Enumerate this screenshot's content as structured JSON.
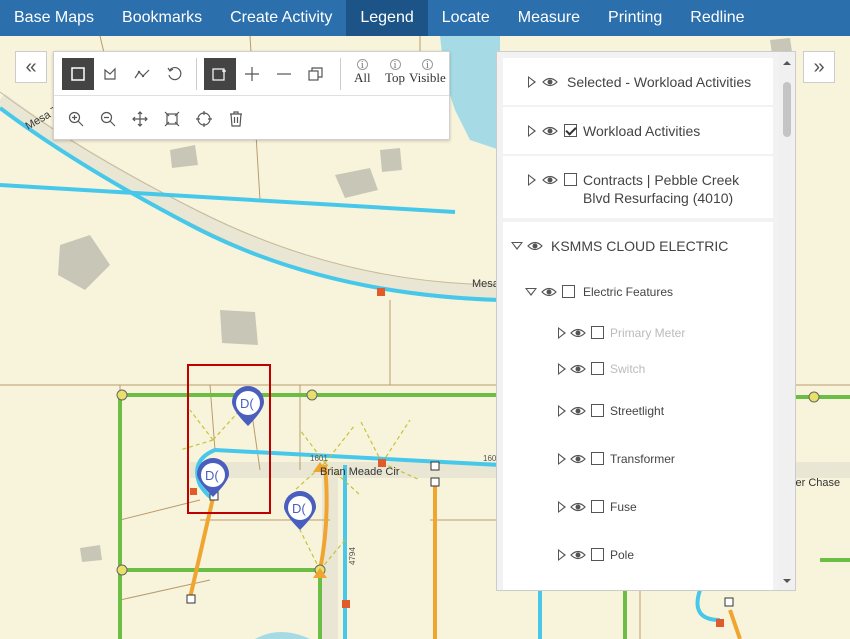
{
  "nav": {
    "items": [
      {
        "label": "Base Maps"
      },
      {
        "label": "Bookmarks"
      },
      {
        "label": "Create Activity"
      },
      {
        "label": "Legend",
        "active": true
      },
      {
        "label": "Locate"
      },
      {
        "label": "Measure"
      },
      {
        "label": "Printing"
      },
      {
        "label": "Redline"
      }
    ]
  },
  "side_buttons": {
    "left_icon": "double-chevron-left-icon",
    "left_glyph": "«",
    "right_icon": "double-chevron-right-icon",
    "right_glyph": "»"
  },
  "toolbar": {
    "row1": [
      "select-rectangle-icon",
      "select-polygon-icon",
      "select-polyline-icon",
      "undo-icon",
      "add-selection-icon",
      "plus-icon",
      "minus-icon",
      "layers-copy-icon"
    ],
    "info_all": "All",
    "info_top": "Top",
    "info_visible": "Visible",
    "info_glyph": "i",
    "row2": [
      "zoom-in-icon",
      "zoom-out-icon",
      "pan-icon",
      "full-extent-icon",
      "locate-icon",
      "trash-icon"
    ]
  },
  "map": {
    "street_labels": [
      "Mesa Tri",
      "Mesa",
      "Brian Meade Cir",
      "ver Chase"
    ],
    "parcel_numbers": [
      "1601",
      "1601",
      "4794"
    ],
    "marker_label": "D(",
    "colors": {
      "background": "#f8f4dc",
      "water": "#a6dbe6",
      "primary_line": "#47c8ea",
      "secondary_line": "#6cbd45",
      "service_line": "#f0a531",
      "parcel_line": "#b89b6d",
      "building": "#c8c6b6",
      "marker": "#4a5fbd",
      "selection": "#c00000"
    }
  },
  "legend": {
    "layers": [
      {
        "label": "Selected - Workload Activities",
        "checkbox": false
      },
      {
        "label": "Workload Activities",
        "checkbox": true,
        "checked": true
      },
      {
        "label": "Contracts | Pebble Creek Blvd Resurfacing (4010)",
        "checkbox": true,
        "checked": false
      }
    ],
    "group": {
      "label": "KSMMS CLOUD ELECTRIC",
      "subgroup": {
        "label": "Electric Features",
        "items": [
          {
            "label": "Primary Meter",
            "dim": true
          },
          {
            "label": "Switch",
            "dim": true
          },
          {
            "label": "Streetlight",
            "dim": false
          },
          {
            "label": "Transformer",
            "dim": false
          },
          {
            "label": "Fuse",
            "dim": false
          },
          {
            "label": "Pole",
            "dim": false
          }
        ]
      }
    }
  }
}
